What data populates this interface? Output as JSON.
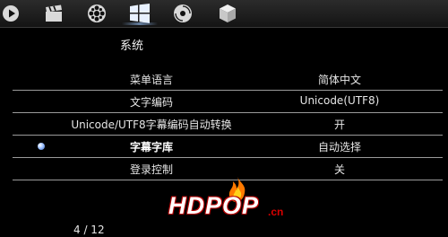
{
  "topbar": {
    "icons": [
      "play-icon",
      "clapperboard-icon",
      "film-reel-icon",
      "windows-logo-icon",
      "disc-icon",
      "cube-icon"
    ],
    "active_index": 3
  },
  "section": {
    "title": "系统"
  },
  "settings": [
    {
      "label": "菜单语言",
      "value": "简体中文"
    },
    {
      "label": "文字编码",
      "value": "Unicode(UTF8)"
    },
    {
      "label": "Unicode/UTF8字幕编码自动转换",
      "value": "开"
    },
    {
      "label": "字幕字库",
      "value": "自动选择",
      "selected": true
    },
    {
      "label": "登录控制",
      "value": "关"
    }
  ],
  "watermark": {
    "text": "HDPOP",
    "suffix": ".cn"
  },
  "pager": {
    "text": "4 / 12"
  },
  "colors": {
    "background": "#000000",
    "divider": "#9a9a9a",
    "text": "#e6e6e6",
    "selection_dot": "#6f98e6",
    "watermark_red": "#d80000"
  }
}
